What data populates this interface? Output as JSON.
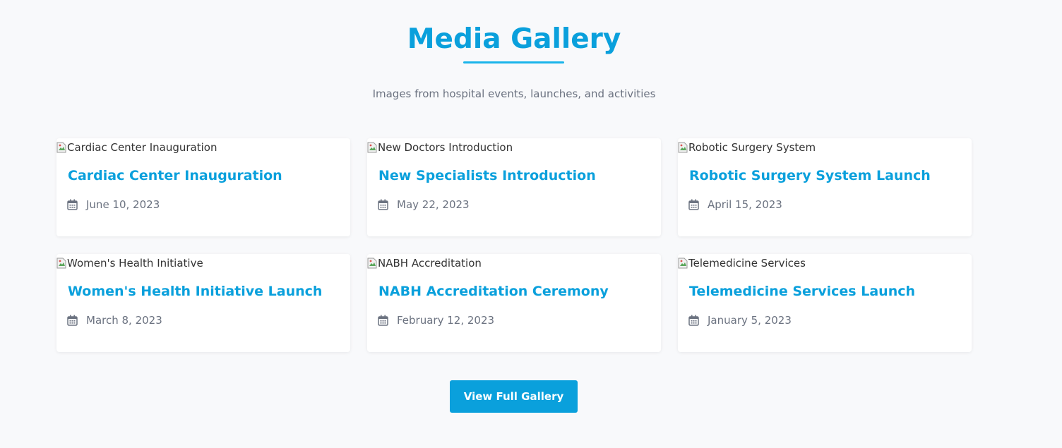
{
  "header": {
    "title": "Media Gallery",
    "subtitle": "Images from hospital events, launches, and activities"
  },
  "gallery": {
    "items": [
      {
        "image_alt": "Cardiac Center Inauguration",
        "title": "Cardiac Center Inauguration",
        "date": "June 10, 2023"
      },
      {
        "image_alt": "New Doctors Introduction",
        "title": "New Specialists Introduction",
        "date": "May 22, 2023"
      },
      {
        "image_alt": "Robotic Surgery System",
        "title": "Robotic Surgery System Launch",
        "date": "April 15, 2023"
      },
      {
        "image_alt": "Women's Health Initiative",
        "title": "Women's Health Initiative Launch",
        "date": "March 8, 2023"
      },
      {
        "image_alt": "NABH Accreditation",
        "title": "NABH Accreditation Ceremony",
        "date": "February 12, 2023"
      },
      {
        "image_alt": "Telemedicine Services",
        "title": "Telemedicine Services Launch",
        "date": "January 5, 2023"
      }
    ],
    "icons": {
      "date": "calendar-icon",
      "image": "broken-image-icon"
    }
  },
  "cta": {
    "label": "View Full Gallery"
  },
  "colors": {
    "accent": "#0aa0dc",
    "background": "#f8f9fb",
    "muted_text": "#6b7280",
    "card": "#ffffff"
  }
}
